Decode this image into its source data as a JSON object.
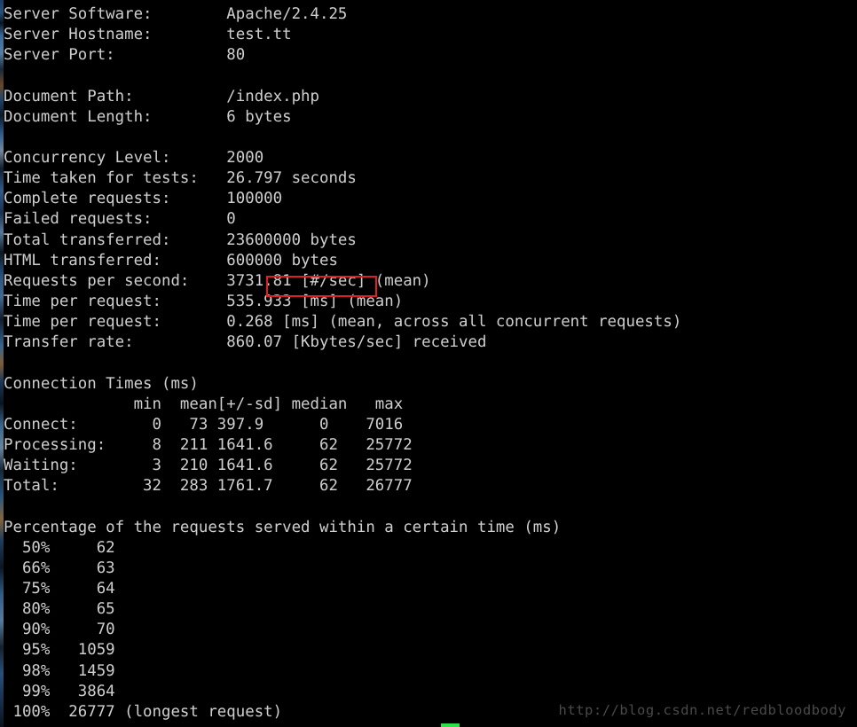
{
  "terminal": {
    "background_color": "#000000",
    "text_color": "#cfcfcf",
    "highlight_color": "#e02020",
    "watermark_color": "#4a4a4a",
    "accent_green": "#2ee04a",
    "lines": [
      "Server Software:        Apache/2.4.25",
      "Server Hostname:        test.tt",
      "Server Port:            80",
      "",
      "Document Path:          /index.php",
      "Document Length:        6 bytes",
      "",
      "Concurrency Level:      2000",
      "Time taken for tests:   26.797 seconds",
      "Complete requests:      100000",
      "Failed requests:        0",
      "Total transferred:      23600000 bytes",
      "HTML transferred:       600000 bytes",
      "Requests per second:    3731.81 [#/sec] (mean)",
      "Time per request:       535.933 [ms] (mean)",
      "Time per request:       0.268 [ms] (mean, across all concurrent requests)",
      "Transfer rate:          860.07 [Kbytes/sec] received",
      "",
      "Connection Times (ms)",
      "              min  mean[+/-sd] median   max",
      "Connect:        0   73 397.9      0    7016",
      "Processing:     8  211 1641.6     62   25772",
      "Waiting:        3  210 1641.6     62   25772",
      "Total:         32  283 1761.7     62   26777",
      "",
      "Percentage of the requests served within a certain time (ms)",
      "  50%     62",
      "  66%     63",
      "  75%     64",
      "  80%     65",
      "  90%     70",
      "  95%   1059",
      "  98%   1459",
      "  99%   3864",
      " 100%  26777 (longest request)"
    ]
  },
  "summary": {
    "server_software_label": "Server Software:",
    "server_software_value": "Apache/2.4.25",
    "server_hostname_label": "Server Hostname:",
    "server_hostname_value": "test.tt",
    "server_port_label": "Server Port:",
    "server_port_value": "80",
    "document_path_label": "Document Path:",
    "document_path_value": "/index.php",
    "document_length_label": "Document Length:",
    "document_length_value": "6 bytes",
    "concurrency_level_label": "Concurrency Level:",
    "concurrency_level_value": "2000",
    "time_taken_label": "Time taken for tests:",
    "time_taken_value": "26.797 seconds",
    "complete_requests_label": "Complete requests:",
    "complete_requests_value": "100000",
    "failed_requests_label": "Failed requests:",
    "failed_requests_value": "0",
    "total_transferred_label": "Total transferred:",
    "total_transferred_value": "23600000 bytes",
    "html_transferred_label": "HTML transferred:",
    "html_transferred_value": "600000 bytes",
    "requests_per_second_label": "Requests per second:",
    "requests_per_second_value": "3731.81",
    "requests_per_second_units": "[#/sec] (mean)",
    "time_per_request_label": "Time per request:",
    "time_per_request_value": "535.933 [ms] (mean)",
    "time_per_request_all_label": "Time per request:",
    "time_per_request_all_value": "0.268 [ms] (mean, across all concurrent requests)",
    "transfer_rate_label": "Transfer rate:",
    "transfer_rate_value": "860.07 [Kbytes/sec] received"
  },
  "connection_times": {
    "title": "Connection Times (ms)",
    "columns": [
      "",
      "min",
      "mean[+/-sd]",
      "median",
      "max"
    ],
    "rows": [
      [
        "Connect:",
        "0",
        "73 397.9",
        "0",
        "7016"
      ],
      [
        "Processing:",
        "8",
        "211 1641.6",
        "62",
        "25772"
      ],
      [
        "Waiting:",
        "3",
        "210 1641.6",
        "62",
        "25772"
      ],
      [
        "Total:",
        "32",
        "283 1761.7",
        "62",
        "26777"
      ]
    ]
  },
  "percentiles": {
    "title": "Percentage of the requests served within a certain time (ms)",
    "rows": [
      {
        "percent": "50%",
        "ms": "62",
        "note": ""
      },
      {
        "percent": "66%",
        "ms": "63",
        "note": ""
      },
      {
        "percent": "75%",
        "ms": "64",
        "note": ""
      },
      {
        "percent": "80%",
        "ms": "65",
        "note": ""
      },
      {
        "percent": "90%",
        "ms": "70",
        "note": ""
      },
      {
        "percent": "95%",
        "ms": "1059",
        "note": ""
      },
      {
        "percent": "98%",
        "ms": "1459",
        "note": ""
      },
      {
        "percent": "99%",
        "ms": "3864",
        "note": ""
      },
      {
        "percent": "100%",
        "ms": "26777",
        "note": "(longest request)"
      }
    ]
  },
  "watermark": {
    "text": "http://blog.csdn.net/redbloodbody"
  }
}
